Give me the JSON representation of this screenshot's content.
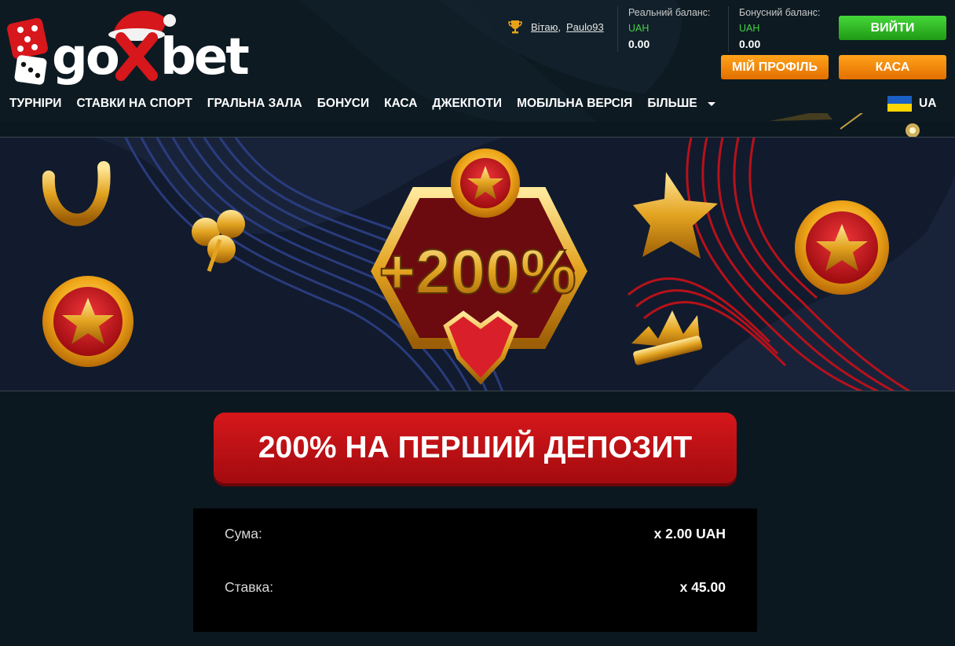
{
  "brand": {
    "name": "goxbet"
  },
  "user": {
    "greeting": "Вітаю,",
    "username": "Paulo93"
  },
  "balances": [
    {
      "label": "Реальний баланс:",
      "currency": "UAH",
      "value": "0.00"
    },
    {
      "label": "Бонусний баланс:",
      "currency": "UAH",
      "value": "0.00"
    }
  ],
  "buttons": {
    "exit": "ВИЙТИ",
    "profile": "МІЙ ПРОФІЛЬ",
    "cash": "КАСА"
  },
  "nav": [
    "ТУРНІРИ",
    "СТАВКИ НА СПОРТ",
    "ГРАЛЬНА ЗАЛА",
    "БОНУСИ",
    "КАСА",
    "ДЖЕКПОТИ",
    "МОБІЛЬНА ВЕРСІЯ",
    "БІЛЬШЕ"
  ],
  "language": {
    "code": "UA"
  },
  "banner": {
    "badge_text": "+200%"
  },
  "promo": {
    "title": "200% НА ПЕРШИЙ ДЕПОЗИТ"
  },
  "details": [
    {
      "label": "Сума:",
      "value": "x 2.00 UAH"
    },
    {
      "label": "Ставка:",
      "value": "x 45.00"
    }
  ],
  "colors": {
    "exit": "#2fbf25",
    "orange": "#f58a0a",
    "promo_red": "#c31217",
    "accent_green": "#46d246"
  }
}
